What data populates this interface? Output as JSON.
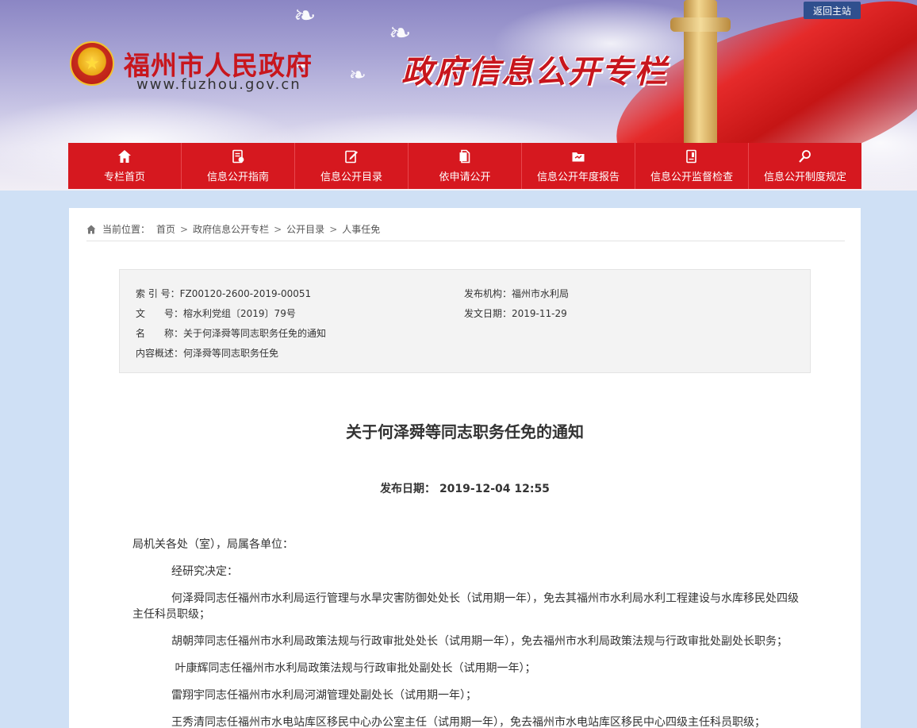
{
  "header": {
    "site_name": "福州市人民政府",
    "site_url": "www.fuzhou.gov.cn",
    "column_title": "政府信息公开专栏",
    "back_home": "返回主站",
    "emblem_icon": "national-emblem-icon",
    "accent_color": "#c8161d"
  },
  "nav": {
    "items": [
      {
        "label": "专栏首页",
        "icon": "home-icon"
      },
      {
        "label": "信息公开指南",
        "icon": "guide-icon"
      },
      {
        "label": "信息公开目录",
        "icon": "catalog-icon"
      },
      {
        "label": "依申请公开",
        "icon": "apply-icon"
      },
      {
        "label": "信息公开年度报告",
        "icon": "report-icon"
      },
      {
        "label": "信息公开监督检查",
        "icon": "inspect-icon"
      },
      {
        "label": "信息公开制度规定",
        "icon": "rules-icon"
      }
    ],
    "bg_color": "#d6181f"
  },
  "breadcrumb": {
    "label": "当前位置：",
    "items": [
      "首页",
      "政府信息公开专栏",
      "公开目录",
      "人事任免"
    ],
    "separator": ">"
  },
  "meta": {
    "index_no": {
      "key": "索 引 号：",
      "value": "FZ00120-2600-2019-00051"
    },
    "doc_no": {
      "key": "文　　号：",
      "value": "榕水利党组〔2019〕79号"
    },
    "name": {
      "key": "名　　称：",
      "value": "关于何泽舜等同志职务任免的通知"
    },
    "summary": {
      "key": "内容概述：",
      "value": "何泽舜等同志职务任免"
    },
    "issuer": {
      "key": "发布机构：",
      "value": "福州市水利局"
    },
    "issue_date": {
      "key": "发文日期：",
      "value": "2019-11-29"
    }
  },
  "article": {
    "title": "关于何泽舜等同志职务任免的通知",
    "pub_date_label": "发布日期：",
    "pub_date": "2019-12-04 12:55",
    "paragraphs": [
      "局机关各处（室），局属各单位：",
      "经研究决定：",
      "何泽舜同志任福州市水利局运行管理与水旱灾害防御处处长（试用期一年），免去其福州市水利局水利工程建设与水库移民处四级主任科员职级；",
      "胡朝萍同志任福州市水利局政策法规与行政审批处处长（试用期一年），免去福州市水利局政策法规与行政审批处副处长职务；",
      " 叶康辉同志任福州市水利局政策法规与行政审批处副处长（试用期一年）；",
      "雷翔宇同志任福州市水利局河湖管理处副处长（试用期一年）；",
      "王秀清同志任福州市水电站库区移民中心办公室主任（试用期一年），免去福州市水电站库区移民中心四级主任科员职级；"
    ]
  }
}
